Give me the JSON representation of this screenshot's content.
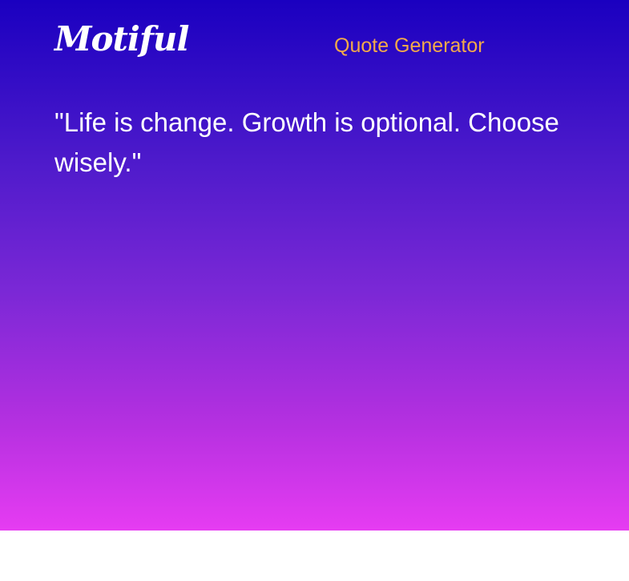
{
  "header": {
    "logo_text": "Motiful",
    "nav_link": "Quote Generator"
  },
  "main": {
    "quote": "\"Life is change. Growth is optional. Choose wisely.\""
  },
  "colors": {
    "gradient_top": "#1a00c0",
    "gradient_bottom": "#e63cf2",
    "nav_link": "#f2a94a",
    "text": "#ffffff"
  }
}
